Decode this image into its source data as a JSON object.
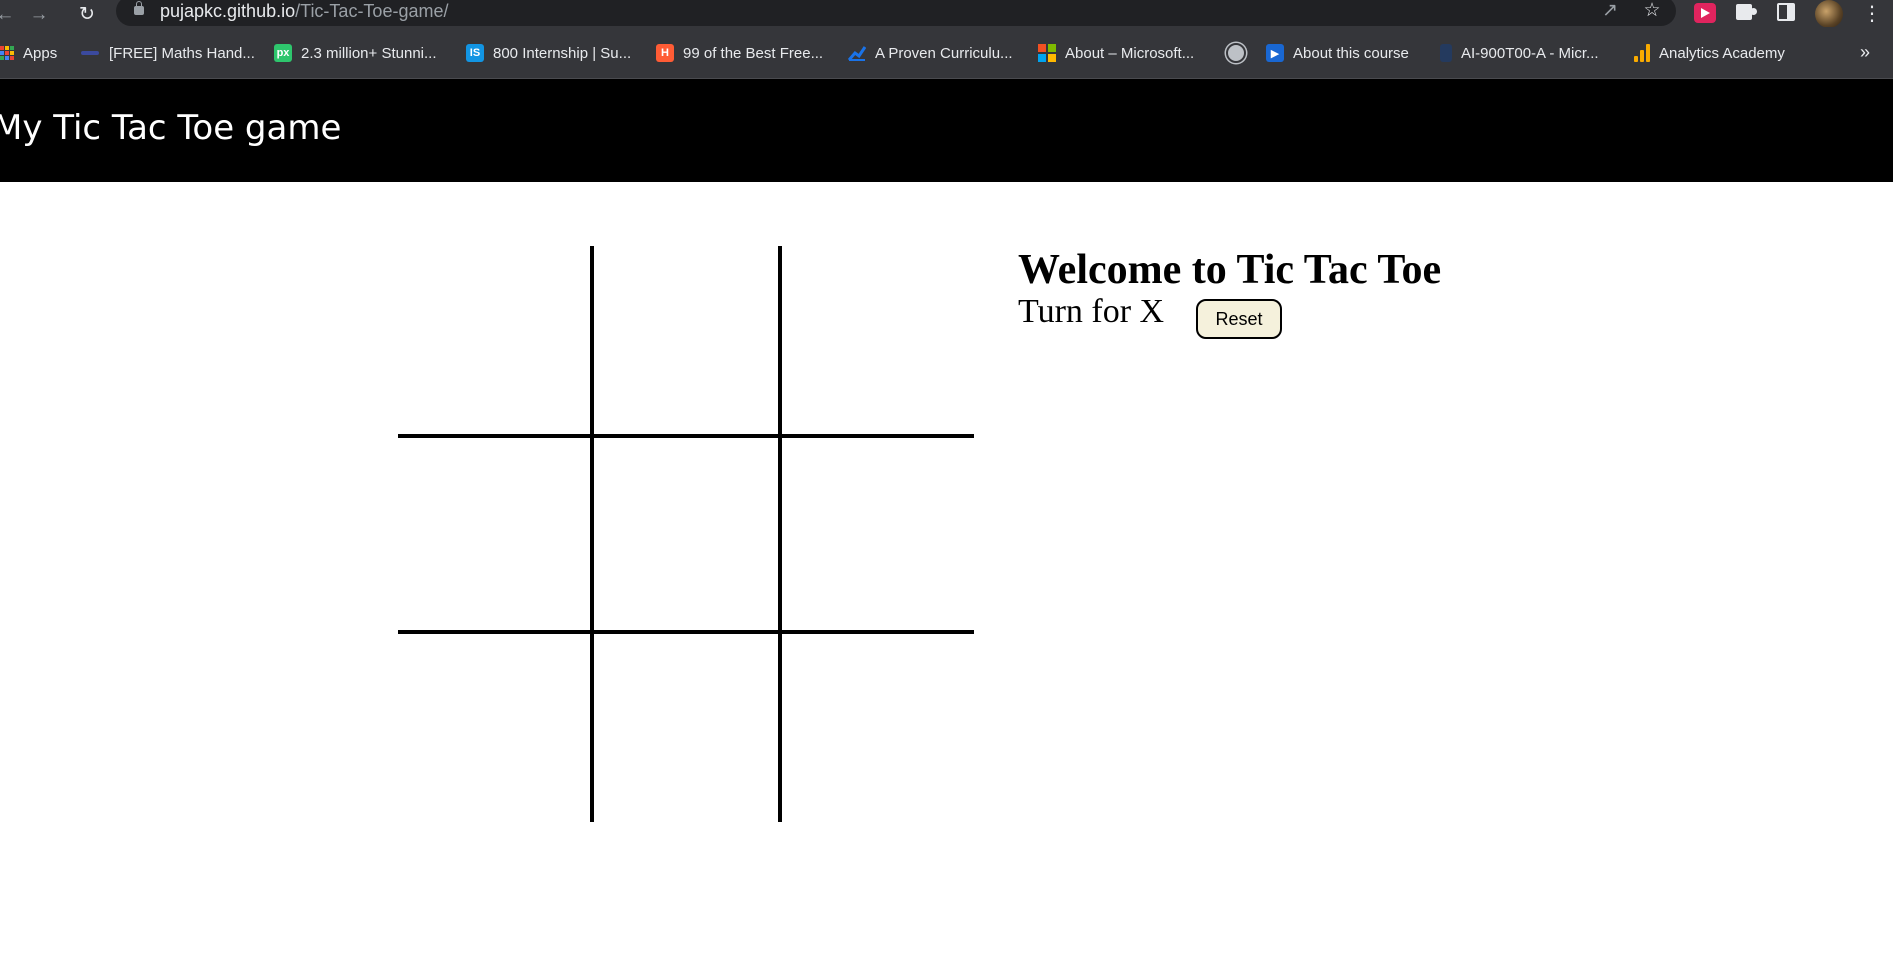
{
  "browser": {
    "url_domain": "pujapkc.github.io",
    "url_path": "/Tic-Tac-Toe-game/",
    "icons": {
      "back": "arrow-left-icon",
      "forward": "arrow-right-icon",
      "reload": "reload-icon",
      "share": "share-icon",
      "bookmark": "star-icon",
      "extension_red": "media-extension-icon",
      "extensions": "puzzle-icon",
      "side_panel": "side-panel-icon",
      "profile": "profile-avatar",
      "menu": "more-vertical-icon"
    }
  },
  "bookmarks": [
    {
      "label": "Apps",
      "icon": "apps-grid-icon"
    },
    {
      "label": "[FREE] Maths Hand...",
      "icon": "maths-favicon"
    },
    {
      "label": "2.3 million+ Stunni...",
      "icon": "pixabay-favicon",
      "glyph": "px",
      "color": "#2ec66d"
    },
    {
      "label": "800 Internship | Su...",
      "icon": "internshala-favicon",
      "glyph": "IS",
      "color": "#1295e3"
    },
    {
      "label": "99 of the Best Free...",
      "icon": "hubspot-favicon",
      "glyph": "H",
      "color": "#ff5c35"
    },
    {
      "label": "A Proven Curriculu...",
      "icon": "chart-favicon"
    },
    {
      "label": "About – Microsoft...",
      "icon": "microsoft-logo-icon"
    },
    {
      "label": "",
      "icon": "globe-icon"
    },
    {
      "label": "About this course",
      "icon": "video-favicon"
    },
    {
      "label": "AI-900T00-A - Micr...",
      "icon": "book-favicon"
    },
    {
      "label": "Analytics Academy",
      "icon": "analytics-favicon"
    }
  ],
  "header": {
    "title": "My Tic Tac Toe game"
  },
  "board": {
    "cells": [
      "",
      "",
      "",
      "",
      "",
      "",
      "",
      "",
      ""
    ]
  },
  "info": {
    "heading": "Welcome to Tic Tac Toe",
    "turn_prefix": "Turn for",
    "turn_player": "X",
    "reset_label": "Reset"
  }
}
